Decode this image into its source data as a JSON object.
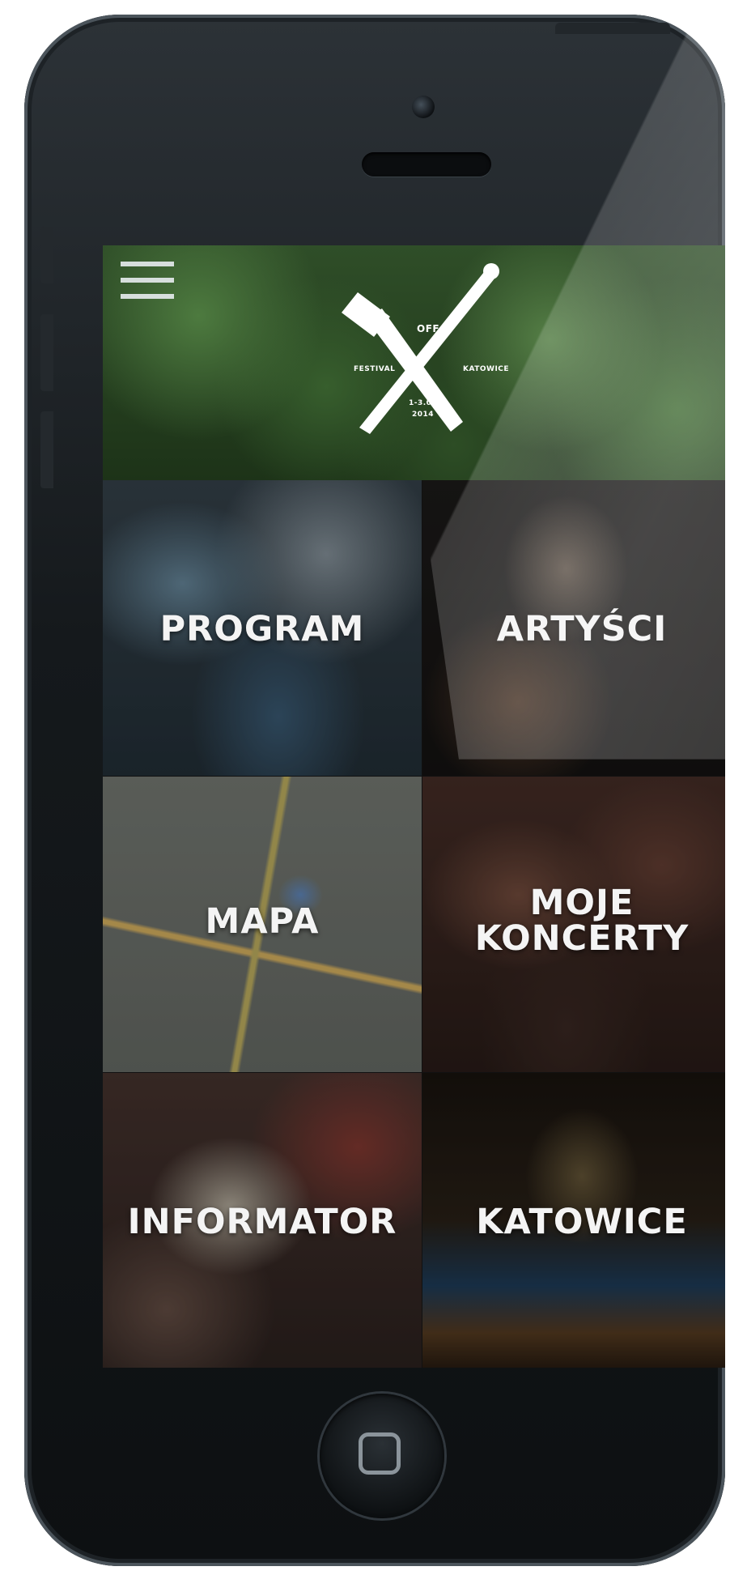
{
  "header": {
    "menu_icon": "hamburger-menu-icon",
    "logo": {
      "name": "off-festival-logo",
      "line_off": "OFF",
      "line_festival": "FESTIVAL",
      "line_katowice": "KATOWICE",
      "line_dates": "1-3.08.",
      "line_year": "2014"
    }
  },
  "tiles": [
    {
      "label": "PROGRAM"
    },
    {
      "label": "ARTYŚCI"
    },
    {
      "label": "MAPA"
    },
    {
      "label_line1": "MOJE",
      "label_line2": "KONCERTY"
    },
    {
      "label": "INFORMATOR"
    },
    {
      "label": "KATOWICE"
    }
  ],
  "device": {
    "home_button_icon": "home-button-icon",
    "camera_icon": "front-camera-icon",
    "speaker_icon": "earpiece-speaker-icon"
  }
}
